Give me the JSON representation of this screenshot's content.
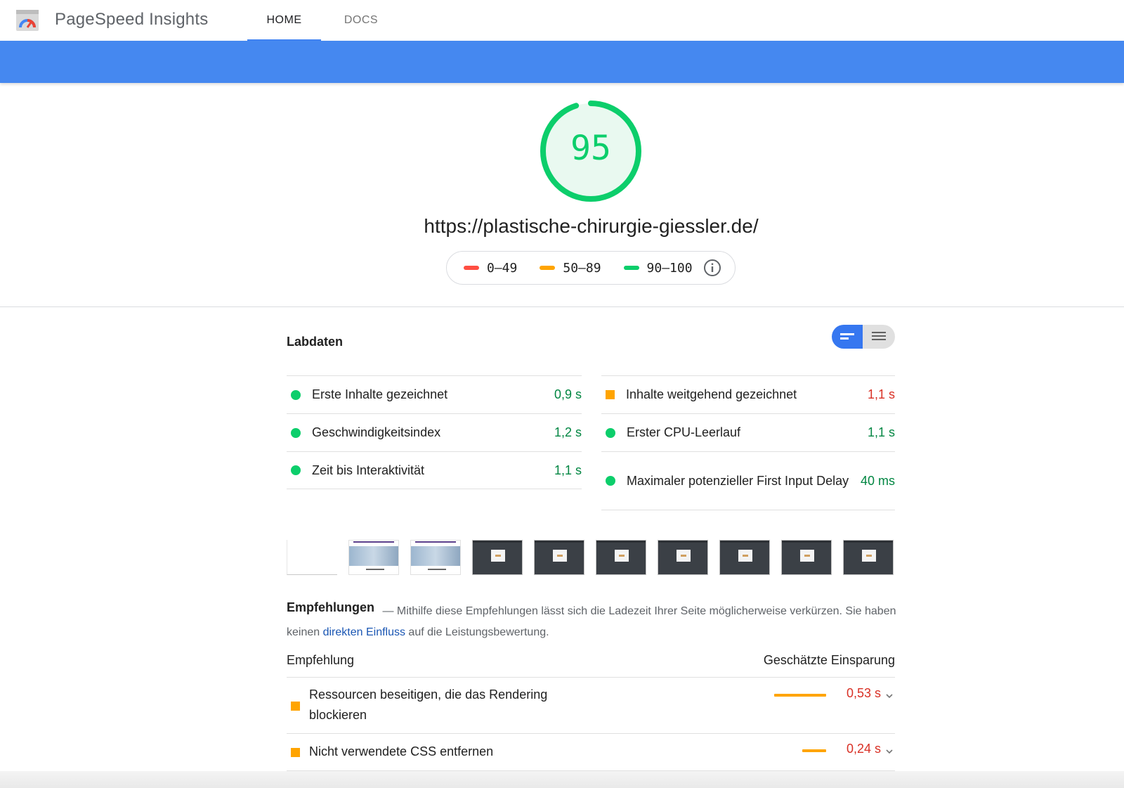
{
  "header": {
    "app_title": "PageSpeed Insights",
    "tabs": [
      {
        "label": "HOME",
        "active": true
      },
      {
        "label": "DOCS",
        "active": false
      }
    ],
    "logo_icon": "pagespeed-gauge-icon"
  },
  "score": {
    "value": "95",
    "url": "https://plastische-chirurgie-giessler.de/",
    "color": "#0cce6b",
    "legend": [
      {
        "range": "0–49",
        "color": "#ff4e42"
      },
      {
        "range": "50–89",
        "color": "#ffa400"
      },
      {
        "range": "90–100",
        "color": "#0cce6b"
      }
    ],
    "info_icon": "info-icon"
  },
  "lab_data": {
    "title": "Labdaten",
    "view_toggle_icons": [
      "bar-view-icon",
      "list-view-icon"
    ],
    "metrics_left": [
      {
        "label": "Erste Inhalte gezeichnet",
        "value": "0,9 s",
        "status": "pass"
      },
      {
        "label": "Geschwindigkeitsindex",
        "value": "1,2 s",
        "status": "pass"
      },
      {
        "label": "Zeit bis Interaktivität",
        "value": "1,1 s",
        "status": "pass"
      }
    ],
    "metrics_right": [
      {
        "label": "Inhalte weitgehend gezeichnet",
        "value": "1,1 s",
        "status": "average"
      },
      {
        "label": "Erster CPU-Leerlauf",
        "value": "1,1 s",
        "status": "pass"
      },
      {
        "label": "Maximaler potenzieller First Input Delay",
        "value": "40 ms",
        "status": "pass"
      }
    ]
  },
  "filmstrip": {
    "frames": [
      "blank",
      "light",
      "light",
      "dark",
      "dark",
      "dark",
      "dark",
      "dark",
      "dark",
      "dark"
    ]
  },
  "recommendations": {
    "title": "Empfehlungen",
    "desc_part1": " — Mithilfe diese Empfehlungen lässt sich die Ladezeit Ihrer Seite möglicherweise verkürzen. Sie haben keinen ",
    "desc_link": "direkten Einfluss",
    "desc_part2": " auf die Leistungsbewertung.",
    "col_recommendation": "Empfehlung",
    "col_savings": "Geschätzte Einsparung",
    "items": [
      {
        "label": "Ressourcen beseitigen, die das Rendering blockieren",
        "savings": "0,53 s",
        "savings_seconds": 0.53
      },
      {
        "label": "Nicht verwendete CSS entfernen",
        "savings": "0,24 s",
        "savings_seconds": 0.24
      }
    ]
  },
  "colors": {
    "accent_blue": "#4588f0",
    "pass_green": "#0cce6b",
    "average_orange": "#ffa400",
    "fail_red": "#ff4e42"
  }
}
